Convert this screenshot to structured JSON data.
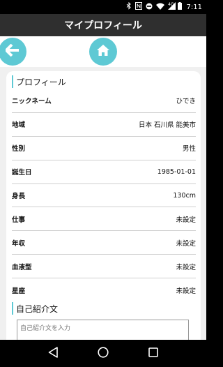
{
  "status_bar": {
    "icons": [
      "bluetooth-icon",
      "nfc-icon",
      "do-not-disturb-icon",
      "wifi-icon",
      "signal-4g-icon",
      "battery-icon"
    ],
    "network_label": "4G",
    "time": "7:11"
  },
  "header": {
    "title": "マイプロフィール"
  },
  "toolbar": {
    "back_icon": "arrow-left-icon",
    "home_icon": "home-icon",
    "accent_color": "#5ec9d4"
  },
  "profile": {
    "section_title": "プロフィール",
    "rows": [
      {
        "label": "ニックネーム",
        "value": "ひでき"
      },
      {
        "label": "地域",
        "value": "日本 石川県 能美市"
      },
      {
        "label": "性別",
        "value": "男性"
      },
      {
        "label": "誕生日",
        "value": "1985-01-01"
      },
      {
        "label": "身長",
        "value": "130cm"
      },
      {
        "label": "仕事",
        "value": "未設定"
      },
      {
        "label": "年収",
        "value": "未設定"
      },
      {
        "label": "血液型",
        "value": "未設定"
      },
      {
        "label": "星座",
        "value": "未設定"
      }
    ]
  },
  "intro": {
    "section_title": "自己紹介文",
    "placeholder": "自己紹介文を入力"
  },
  "nav": {
    "back_icon": "triangle-back-icon",
    "home_icon": "circle-home-icon",
    "recents_icon": "square-recents-icon"
  }
}
